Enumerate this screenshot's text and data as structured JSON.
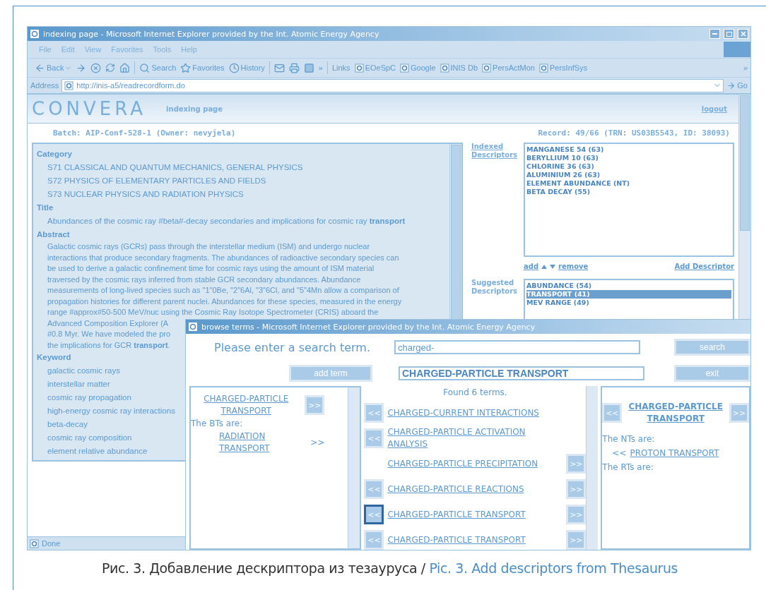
{
  "browser": {
    "title": "indexing page - Microsoft Internet Explorer provided by the Int. Atomic Energy Agency",
    "menu": [
      "File",
      "Edit",
      "View",
      "Favorites",
      "Tools",
      "Help"
    ],
    "toolbar": {
      "back": "Back",
      "search": "Search",
      "favorites": "Favorites",
      "history": "History",
      "more": "»",
      "links_label": "Links",
      "links": [
        "EOeSpC",
        "Google",
        "INIS Db",
        "PersActMon",
        "PersInfSys"
      ],
      "links_more": "»"
    },
    "address": {
      "label": "Address",
      "value": "http://inis-a5/readrecordform.do",
      "go": "Go"
    },
    "status": "Done"
  },
  "page": {
    "brand": "CONVERA",
    "title": "indexing page",
    "logout": "logout",
    "batch": "Batch: AIP-Conf-528-1 (Owner: nevyjela)",
    "record": "Record: 49/66 (TRN: US03B5543, ID: 38093)",
    "sections": [
      {
        "heading": "Category",
        "kind": "items",
        "lines": [
          "S71 CLASSICAL AND QUANTUM MECHANICS, GENERAL PHYSICS",
          "S72 PHYSICS OF ELEMENTARY PARTICLES AND FIELDS",
          "S73 NUCLEAR PHYSICS AND RADIATION PHYSICS"
        ]
      },
      {
        "heading": "Title",
        "kind": "items",
        "lines": [
          "Abundances of the cosmic ray #beta#-decay secondaries and implications for cosmic ray **transport**"
        ]
      },
      {
        "heading": "Abstract",
        "kind": "paragraph",
        "lines": [
          "Galactic cosmic rays (GCRs) pass through the interstellar medium (ISM) and undergo nuclear",
          "interactions that produce secondary fragments. The abundances of radioactive secondary species can",
          "be used to derive a galactic confinement time for cosmic rays using the amount of ISM material",
          "traversed by the cosmic rays inferred from stable GCR secondary abundances. Abundance",
          "measurements of long-lived species such as \"1\"0Be, \"2\"6Al, \"3\"6Cl, and \"5\"4Mn allow a comparison of",
          "propagation histories for different parent nuclei. Abundances for these species, measured in the energy",
          "range #approx#50-500 MeV/nuc using the Cosmic Ray Isotope Spectrometer (CRIS) aboard the",
          "Advanced Composition Explorer (A",
          "#0.8 Myr. We have modeled the pro",
          "the implications for GCR **transport**."
        ]
      },
      {
        "heading": "Keyword",
        "kind": "items",
        "lines": [
          "galactic cosmic rays",
          "interstellar matter",
          "cosmic ray propagation",
          "high-energy cosmic ray interactions",
          "beta-decay",
          "cosmic ray composition",
          "element relative abundance"
        ]
      }
    ],
    "indexed": {
      "label": "Indexed Descriptors",
      "items": [
        "MANGANESE 54 (63)",
        "BERYLLIUM 10 (63)",
        "CHLORINE 36 (63)",
        "ALUMINIUM 26 (63)",
        "ELEMENT ABUNDANCE (NT)",
        "BETA DECAY (55)"
      ]
    },
    "actions": {
      "add": "add",
      "remove": "remove",
      "add_descriptor": "Add Descriptor"
    },
    "suggested": {
      "label": "Suggested Descriptors",
      "items": [
        {
          "label": "ABUNDANCE (54)",
          "selected": false
        },
        {
          "label": "TRANSPORT (41)",
          "selected": true
        },
        {
          "label": "MEV RANGE (49)",
          "selected": false
        }
      ]
    }
  },
  "popup": {
    "title": "browse terms - Microsoft Internet Explorer provided by the Int. Atomic Energy Agency",
    "prompt": "Please enter a search term.",
    "search_value": "charged-",
    "search": "search",
    "add_term": "add term",
    "term_value": "CHARGED-PARTICLE TRANSPORT",
    "exit": "exit",
    "broader": {
      "term": "CHARGED-PARTICLE TRANSPORT",
      "next": ">>",
      "heading": "The BTs are:",
      "items": [
        {
          "label": "RADIATION TRANSPORT",
          "marker": ">>"
        }
      ]
    },
    "results": {
      "found": "Found 6 terms.",
      "terms": [
        {
          "label": "CHARGED-CURRENT INTERACTIONS",
          "left": "<<",
          "focused": false
        },
        {
          "label": "CHARGED-PARTICLE ACTIVATION ANALYSIS",
          "left": "<<",
          "focused": false
        },
        {
          "label": "CHARGED-PARTICLE PRECIPITATION",
          "right": ">>",
          "focused": false
        },
        {
          "label": "CHARGED-PARTICLE REACTIONS",
          "left": "<<",
          "right": ">>",
          "focused": false
        },
        {
          "label": "CHARGED-PARTICLE TRANSPORT",
          "left": "<<",
          "right": ">>",
          "focused": true
        },
        {
          "label": "CHARGED-PARTICLE TRANSPORT",
          "left": "<<",
          "right": ">>",
          "focused": false
        }
      ]
    },
    "narrower": {
      "prev": "<<",
      "term": "CHARGED-PARTICLE TRANSPORT",
      "next": ">>",
      "nt_heading": "The NTs are:",
      "nts": [
        {
          "marker": "<<",
          "label": "PROTON TRANSPORT"
        }
      ],
      "rt_heading": "The RTs are:"
    }
  },
  "caption": {
    "ru": "Рис. 3. Добавление дескриптора из тезауруса / ",
    "en": "Pic. 3. Add descriptors from Thesaurus"
  }
}
